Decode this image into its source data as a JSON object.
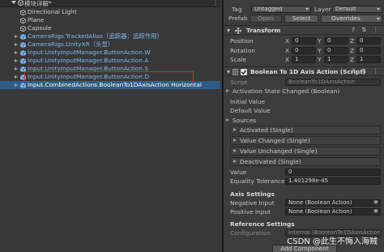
{
  "hierarchy": {
    "scene_title": "模块详解*",
    "items": [
      {
        "label": "Directional Light",
        "color": "white",
        "expandable": false
      },
      {
        "label": "Plane",
        "color": "white",
        "expandable": false
      },
      {
        "label": "Capsule",
        "color": "white",
        "expandable": false
      },
      {
        "label": "CameraRigs.TrackedAlias（追踪器：追踪作用）",
        "color": "blue",
        "expandable": true
      },
      {
        "label": "CameraRigs.UnityXR（头显）",
        "color": "blue",
        "expandable": true
      },
      {
        "label": "Input.UnityInputManager.ButtonAction.W",
        "color": "blue",
        "expandable": true
      },
      {
        "label": "Input.UnityInputManager.ButtonAction.A",
        "color": "blue",
        "expandable": true
      },
      {
        "label": "Input.UnityInputManager.ButtonAction.S",
        "color": "blue",
        "expandable": true
      },
      {
        "label": "Input.UnityInputManager.ButtonAction.D",
        "color": "blue",
        "expandable": true
      },
      {
        "label": "Input.CombinedActions.BooleanTo1DAxisAction Horizontal",
        "color": "blue",
        "expandable": true,
        "selected": true
      }
    ]
  },
  "inspector": {
    "tag_label": "Tag",
    "tag_value": "Untagged",
    "layer_label": "Layer",
    "layer_value": "Default",
    "prefab_label": "Prefab",
    "prefab_open": "Open",
    "prefab_select": "Select",
    "prefab_overrides": "Overrides",
    "transform": {
      "title": "Transform",
      "position_label": "Position",
      "rotation_label": "Rotation",
      "scale_label": "Scale",
      "position": {
        "x": "0",
        "y": "0",
        "z": "0"
      },
      "rotation": {
        "x": "0",
        "y": "0",
        "z": "0"
      },
      "scale": {
        "x": "1",
        "y": "1",
        "z": "1"
      },
      "axis_x": "X",
      "axis_y": "Y",
      "axis_z": "Z"
    },
    "component": {
      "title": "Boolean To 1D Axis Action (Script)",
      "script_label": "Script",
      "script_value": "BooleanTo1DAxisAction",
      "activation_event": "Activation State Changed (Boolean)",
      "initial_value_label": "Initial Value",
      "default_value_label": "Default Value",
      "sources_label": "Sources",
      "activated_event": "Activated (Single)",
      "value_changed_event": "Value Changed (Single)",
      "value_unchanged_event": "Value Unchanged (Single)",
      "deactivated_event": "Deactivated (Single)",
      "value_label": "Value",
      "value_value": "0",
      "tolerance_label": "Equality Tolerance",
      "tolerance_value": "1.401298e-45",
      "axis_settings_title": "Axis Settings",
      "negative_input_label": "Negative Input",
      "negative_input_value": "None (Boolean Action)",
      "positive_input_label": "Positive Input",
      "positive_input_value": "None (Boolean Action)",
      "reference_settings_title": "Reference Settings",
      "configuration_label": "Configuration",
      "configuration_value": "Internal (BooleanTo1DAxisAction"
    },
    "add_component": "Add Component"
  },
  "watermark": "CSDN @此生不悔入海贼",
  "colors": {
    "selection": "#2c5d87",
    "prefab_blue": "#7fb7ee",
    "highlight_box": "#e0252a"
  }
}
